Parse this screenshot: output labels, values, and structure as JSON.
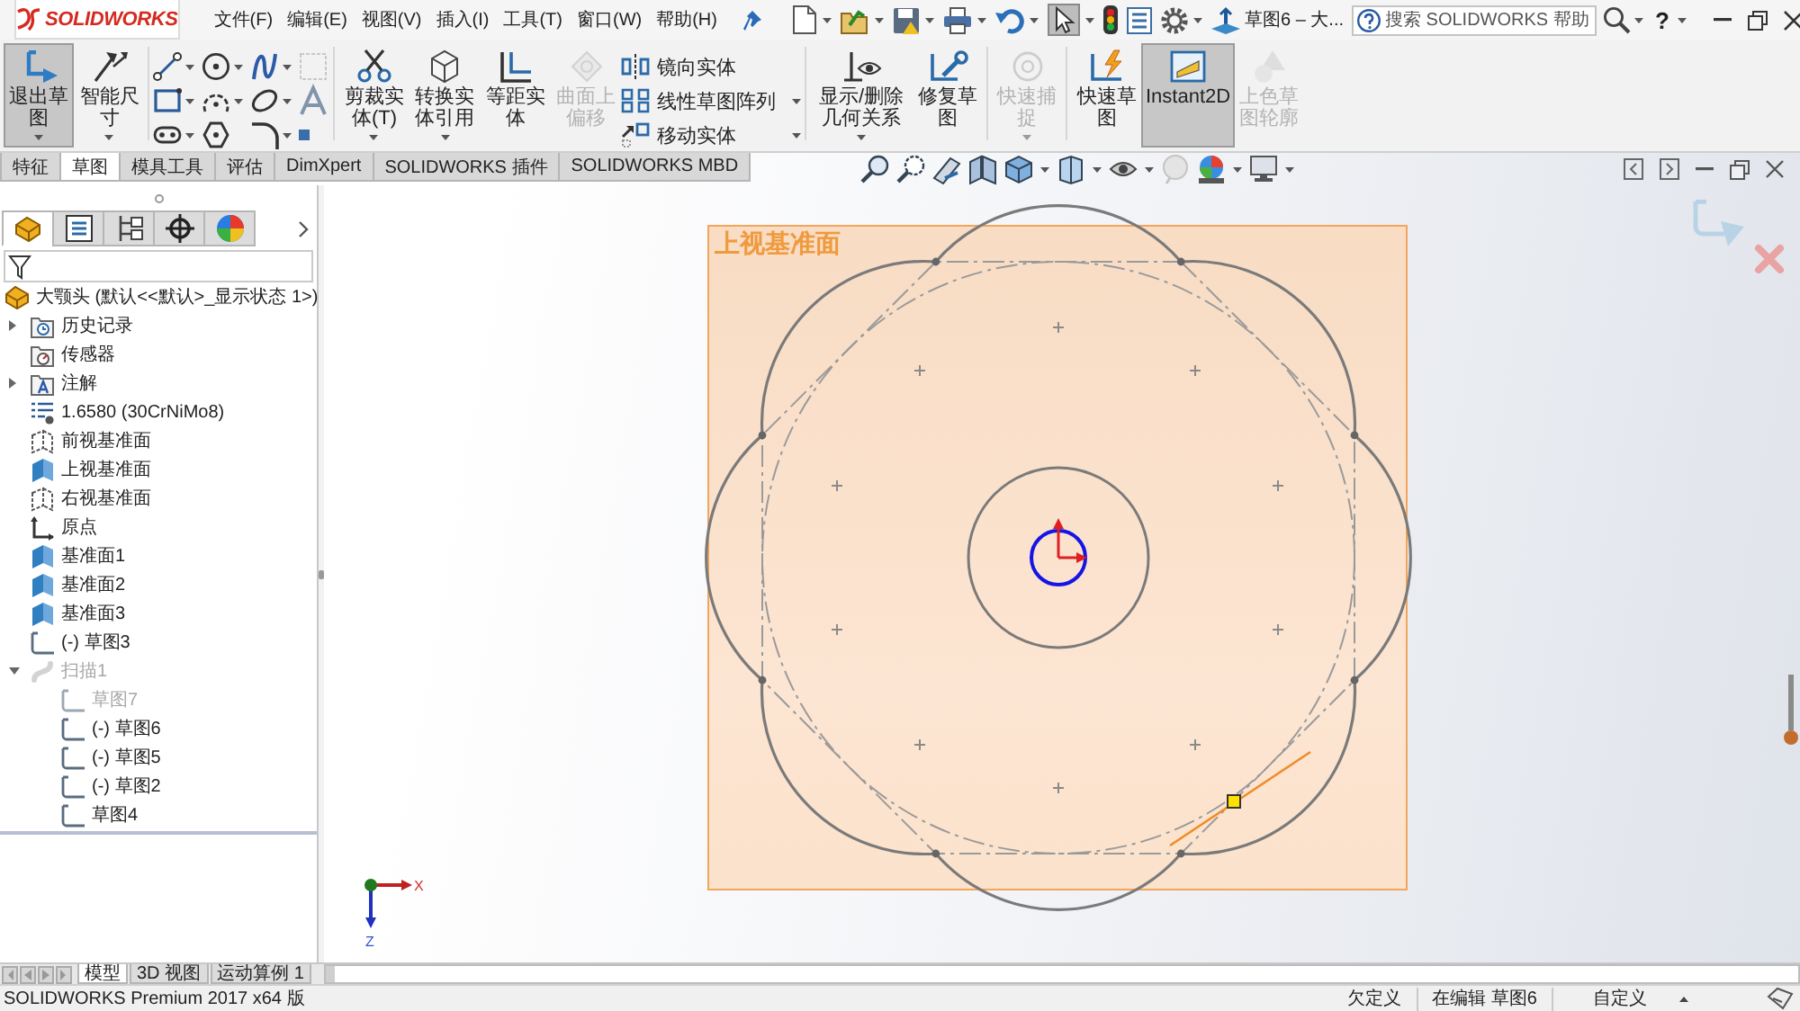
{
  "app_bar": {
    "logo": "SOLIDWORKS",
    "menus": [
      {
        "label": "文件(F)"
      },
      {
        "label": "编辑(E)"
      },
      {
        "label": "视图(V)"
      },
      {
        "label": "插入(I)"
      },
      {
        "label": "工具(T)"
      },
      {
        "label": "窗口(W)"
      },
      {
        "label": "帮助(H)"
      }
    ],
    "select_tool": {
      "selected": true
    },
    "document_title": "草图6 – 大...",
    "search": {
      "placeholder": "搜索 SOLIDWORKS 帮助"
    },
    "help": "?"
  },
  "ribbon": {
    "sketch": [
      {
        "label": "退出草图",
        "selected": true,
        "disabled": false,
        "dropdown": true
      },
      {
        "label": "智能尺寸",
        "selected": false,
        "disabled": false,
        "dropdown": true
      }
    ],
    "entities": [
      {
        "label": "剪裁实体(T)",
        "selected": false,
        "disabled": false,
        "dropdown": true
      },
      {
        "label": "转换实体引用",
        "selected": false,
        "disabled": false,
        "dropdown": true
      },
      {
        "label": "等距实体",
        "selected": false,
        "disabled": false,
        "dropdown": false
      },
      {
        "label": "曲面上偏移",
        "selected": false,
        "disabled": true,
        "dropdown": false
      }
    ],
    "entity_list": [
      {
        "label": "镜向实体",
        "dropdown": false
      },
      {
        "label": "线性草图阵列",
        "dropdown": true
      },
      {
        "label": "移动实体",
        "dropdown": true
      }
    ],
    "relations": [
      {
        "label": "显示/删除几何关系",
        "selected": false,
        "disabled": false,
        "dropdown": true
      },
      {
        "label": "修复草图",
        "selected": false,
        "disabled": false,
        "dropdown": false
      }
    ],
    "snaps": [
      {
        "label": "快速捕捉",
        "selected": false,
        "disabled": true,
        "dropdown": true
      }
    ],
    "modes": [
      {
        "label": "快速草图",
        "selected": false,
        "disabled": false,
        "dropdown": false
      },
      {
        "label": "Instant2D",
        "selected": true,
        "disabled": false,
        "dropdown": false
      },
      {
        "label": "上色草图轮廓",
        "selected": false,
        "disabled": true,
        "dropdown": false
      }
    ]
  },
  "command_tabs": [
    {
      "label": "特征",
      "selected": false
    },
    {
      "label": "草图",
      "selected": true
    },
    {
      "label": "模具工具",
      "selected": false
    },
    {
      "label": "评估",
      "selected": false
    },
    {
      "label": "DimXpert",
      "selected": false
    },
    {
      "label": "SOLIDWORKS 插件",
      "selected": false
    },
    {
      "label": "SOLIDWORKS MBD",
      "selected": false
    }
  ],
  "feature_manager": {
    "panel_tabs": [
      {
        "selected": true
      },
      {
        "selected": false
      },
      {
        "selected": false
      },
      {
        "selected": false
      },
      {
        "selected": false
      }
    ],
    "tree": [
      {
        "kind": "part",
        "label": "大颚头 (默认<<默认>_显示状态 1>)",
        "dimmed": false,
        "children": [
          {
            "kind": "history",
            "label": "历史记录",
            "dimmed": false,
            "expanded": false
          },
          {
            "kind": "sensors",
            "label": "传感器",
            "dimmed": false
          },
          {
            "kind": "annotations",
            "label": "注解",
            "dimmed": false,
            "expanded": false
          },
          {
            "kind": "material",
            "label": "1.6580 (30CrNiMo8)",
            "dimmed": false
          },
          {
            "kind": "plane",
            "label": "前视基准面",
            "dimmed": false,
            "visible": false
          },
          {
            "kind": "plane",
            "label": "上视基准面",
            "dimmed": false,
            "visible": true
          },
          {
            "kind": "plane",
            "label": "右视基准面",
            "dimmed": false,
            "visible": false
          },
          {
            "kind": "origin",
            "label": "原点",
            "dimmed": false
          },
          {
            "kind": "plane",
            "label": "基准面1",
            "dimmed": false,
            "visible": true
          },
          {
            "kind": "plane",
            "label": "基准面2",
            "dimmed": false,
            "visible": true
          },
          {
            "kind": "plane",
            "label": "基准面3",
            "dimmed": false,
            "visible": true
          },
          {
            "kind": "sketch",
            "label": "(-) 草图3",
            "dimmed": false
          },
          {
            "kind": "sweep",
            "label": "扫描1",
            "dimmed": true,
            "expanded": true,
            "children": [
              {
                "kind": "sketch",
                "label": "草图7",
                "dimmed": true
              },
              {
                "kind": "sketch",
                "label": "(-) 草图6",
                "dimmed": false
              },
              {
                "kind": "sketch",
                "label": "(-) 草图5",
                "dimmed": false
              },
              {
                "kind": "sketch",
                "label": "(-) 草图2",
                "dimmed": false
              },
              {
                "kind": "sketch",
                "label": "草图4",
                "dimmed": false
              }
            ]
          }
        ]
      }
    ]
  },
  "canvas": {
    "plane_label": "上视基准面",
    "triad": {
      "x_label": "X",
      "z_label": "Z"
    }
  },
  "view_tabs": [
    {
      "label": "模型",
      "selected": true
    },
    {
      "label": "3D 视图",
      "selected": false
    },
    {
      "label": "运动算例 1",
      "selected": false
    }
  ],
  "status_bar": {
    "product": "SOLIDWORKS Premium 2017 x64 版",
    "sketch_state": "欠定义",
    "editing": "在编辑 草图6",
    "units": "自定义"
  }
}
